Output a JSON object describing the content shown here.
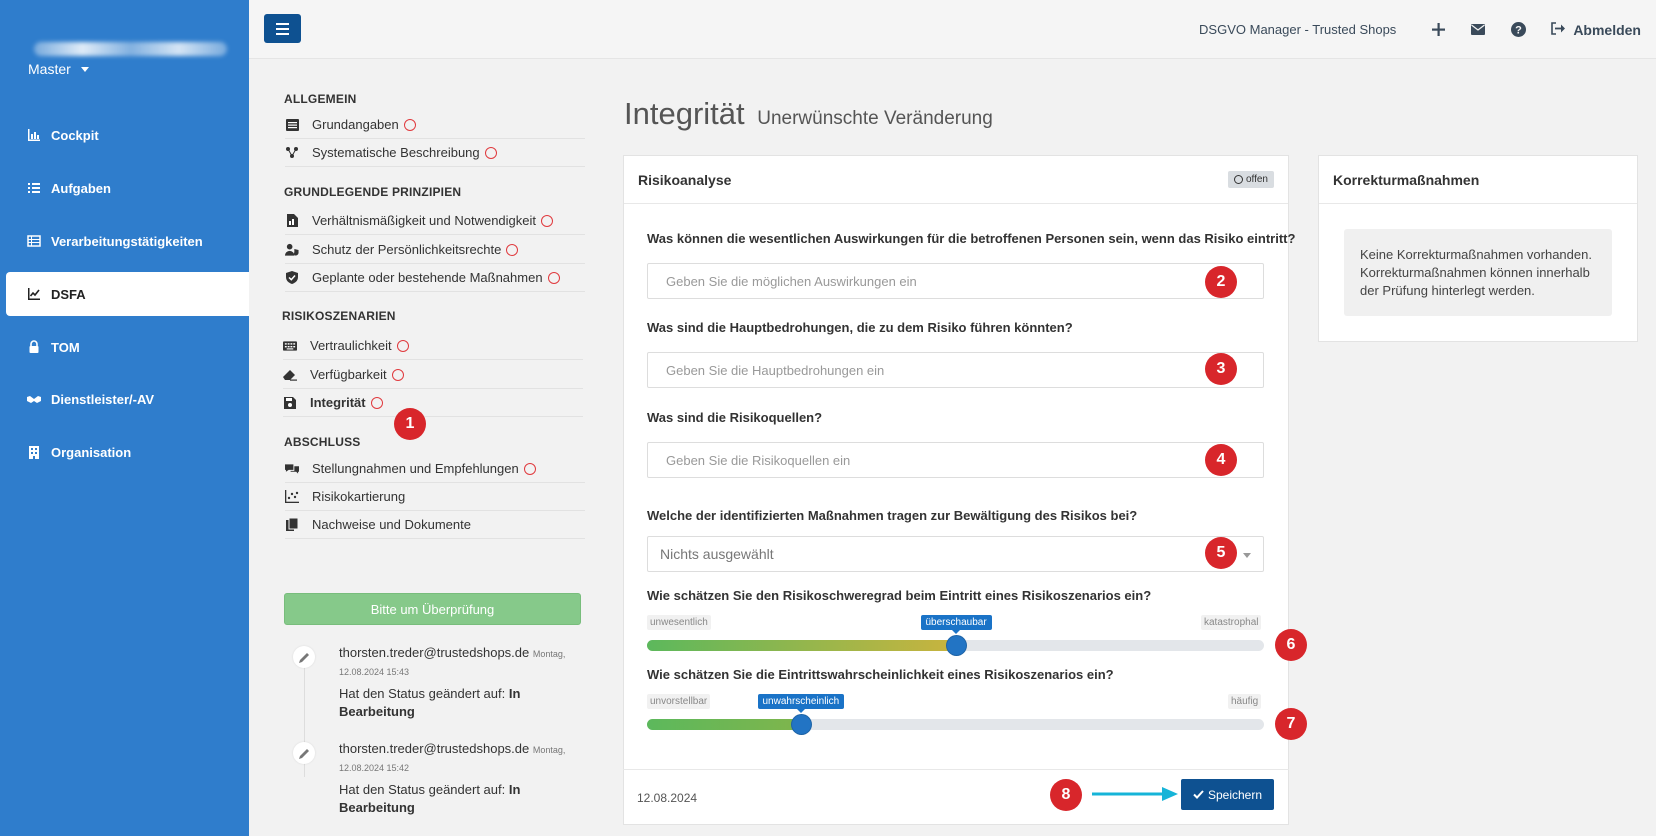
{
  "sidebar": {
    "account_selector": "Master",
    "items": [
      {
        "label": "Cockpit",
        "icon": "chart-icon"
      },
      {
        "label": "Aufgaben",
        "icon": "list-icon"
      },
      {
        "label": "Verarbeitungstätigkeiten",
        "icon": "table-icon"
      },
      {
        "label": "DSFA",
        "icon": "line-chart-icon",
        "active": true
      },
      {
        "label": "TOM",
        "icon": "lock-icon"
      },
      {
        "label": "Dienstleister/-AV",
        "icon": "handshake-icon"
      },
      {
        "label": "Organisation",
        "icon": "building-icon"
      }
    ]
  },
  "topbar": {
    "app_title": "DSGVO Manager - Trusted Shops",
    "logout_label": "Abmelden"
  },
  "sections": {
    "allgemein": {
      "title": "ALLGEMEIN",
      "items": [
        {
          "label": "Grundangaben",
          "status": "offen"
        },
        {
          "label": "Systematische Beschreibung",
          "status": "offen"
        }
      ]
    },
    "prinzipien": {
      "title": "GRUNDLEGENDE PRINZIPIEN",
      "items": [
        {
          "label": "Verhältnismäßigkeit und Notwendigkeit",
          "status": "offen"
        },
        {
          "label": "Schutz der Persönlichkeitsrechte",
          "status": "offen"
        },
        {
          "label": "Geplante oder bestehende Maßnahmen",
          "status": "offen"
        }
      ]
    },
    "risiko": {
      "title": "RISIKOSZENARIEN",
      "items": [
        {
          "label": "Vertraulichkeit",
          "status": "offen"
        },
        {
          "label": "Verfügbarkeit",
          "status": "offen"
        },
        {
          "label": "Integrität",
          "status": "offen",
          "active": true
        }
      ]
    },
    "abschluss": {
      "title": "ABSCHLUSS",
      "items": [
        {
          "label": "Stellungnahmen und Empfehlungen",
          "status": "offen"
        },
        {
          "label": "Risikokartierung"
        },
        {
          "label": "Nachweise und Dokumente"
        }
      ]
    }
  },
  "review_button": "Bitte um Überprüfung",
  "timeline": [
    {
      "email": "thorsten.treder@trustedshops.de",
      "date_prefix": "Montag,",
      "date": "12.08.2024 15:43",
      "status_text": "Hat den Status geändert auf:",
      "status_value": "In Bearbeitung"
    },
    {
      "email": "thorsten.treder@trustedshops.de",
      "date_prefix": "Montag,",
      "date": "12.08.2024 15:42",
      "status_text": "Hat den Status geändert auf:",
      "status_value": "In Bearbeitung"
    }
  ],
  "page": {
    "title": "Integrität",
    "subtitle": "Unerwünschte Veränderung"
  },
  "risk_panel": {
    "title": "Risikoanalyse",
    "status_badge": "offen",
    "q_auswirkungen": "Was können die wesentlichen Auswirkungen für die betroffenen Personen sein, wenn das Risiko eintritt?",
    "ph_auswirkungen": "Geben Sie die möglichen Auswirkungen ein",
    "q_bedrohungen": "Was sind die Hauptbedrohungen, die zu dem Risiko führen könnten?",
    "ph_bedrohungen": "Geben Sie die Hauptbedrohungen ein",
    "q_quellen": "Was sind die Risikoquellen?",
    "ph_quellen": "Geben Sie die Risikoquellen ein",
    "q_massnahmen": "Welche der identifizierten Maßnahmen tragen zur Bewältigung des Risikos bei?",
    "massnahmen_value": "Nichts ausgewählt",
    "q_schweregrad": "Wie schätzen Sie den Risikoschweregrad beim Eintritt eines Risikoszenarios ein?",
    "schweregrad": {
      "min_label": "unwesentlich",
      "max_label": "katastrophal",
      "value_label": "überschaubar",
      "level": 0.5
    },
    "q_wahrscheinlichkeit": "Wie schätzen Sie die Eintrittswahrscheinlichkeit eines Risikoszenarios ein?",
    "wahrscheinlichkeit": {
      "min_label": "unvorstellbar",
      "max_label": "häufig",
      "value_label": "unwahrscheinlich",
      "level": 0.25
    },
    "footer_date": "12.08.2024",
    "save_label": "Speichern"
  },
  "korrektur_panel": {
    "title": "Korrekturmaßnahmen",
    "body": "Keine Korrekturmaßnahmen vorhanden. Korrekturmaßnahmen können innerhalb der Prüfung hinterlegt werden."
  },
  "annotations": [
    "1",
    "2",
    "3",
    "4",
    "5",
    "6",
    "7",
    "8"
  ],
  "colors": {
    "sidebar": "#2f7dcc",
    "primary": "#0e5191",
    "annotation": "#d8262b",
    "review": "#86c98a"
  }
}
